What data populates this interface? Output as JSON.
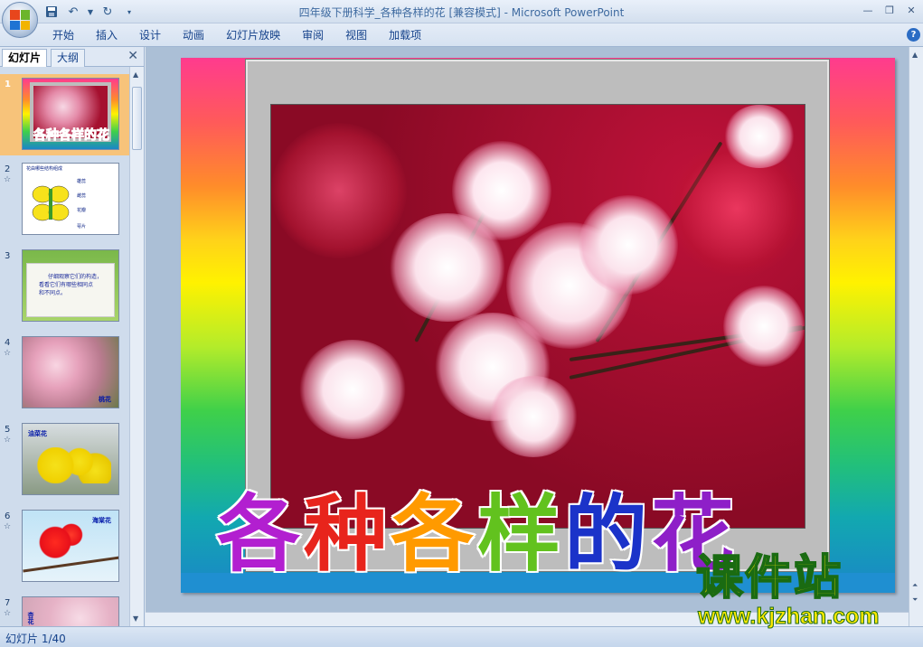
{
  "window": {
    "title": "四年级下册科学_各种各样的花 [兼容模式] - Microsoft PowerPoint"
  },
  "ribbon": {
    "tabs": [
      "开始",
      "插入",
      "设计",
      "动画",
      "幻灯片放映",
      "审阅",
      "视图",
      "加载项"
    ]
  },
  "left_pane": {
    "tabs": [
      "幻灯片",
      "大纲"
    ],
    "slides": [
      {
        "num": "1",
        "title": "各种各样的花"
      },
      {
        "num": "2",
        "title": "",
        "lines": [
          "花由哪些结构组成",
          "雄蕊",
          "雌蕊",
          "花瓣",
          "萼片"
        ]
      },
      {
        "num": "3",
        "title": "",
        "lines": [
          "仔细观察它们的构造，",
          "看看它们有哪些相同点",
          "和不同点。"
        ]
      },
      {
        "num": "4",
        "title": "",
        "label": "桃花"
      },
      {
        "num": "5",
        "title": "",
        "label": "油菜花"
      },
      {
        "num": "6",
        "title": "",
        "label": "海棠花"
      },
      {
        "num": "7",
        "title": "",
        "label": "杏花"
      }
    ]
  },
  "slide": {
    "title_chars": [
      {
        "char": "各",
        "color": "#b21fd0"
      },
      {
        "char": "种",
        "color": "#e8241c"
      },
      {
        "char": "各",
        "color": "#ff9a00"
      },
      {
        "char": "样",
        "color": "#62c21e"
      },
      {
        "char": "的",
        "color": "#1b33c9"
      },
      {
        "char": "花",
        "color": "#8e1fc8"
      }
    ]
  },
  "watermark": {
    "cn": "课件站",
    "url": "www.kjzhan.com"
  },
  "status": {
    "slide_info": "幻灯片 1/40"
  },
  "colors": {
    "accent": "#15428b",
    "selected_thumb": "#f7c37a"
  }
}
